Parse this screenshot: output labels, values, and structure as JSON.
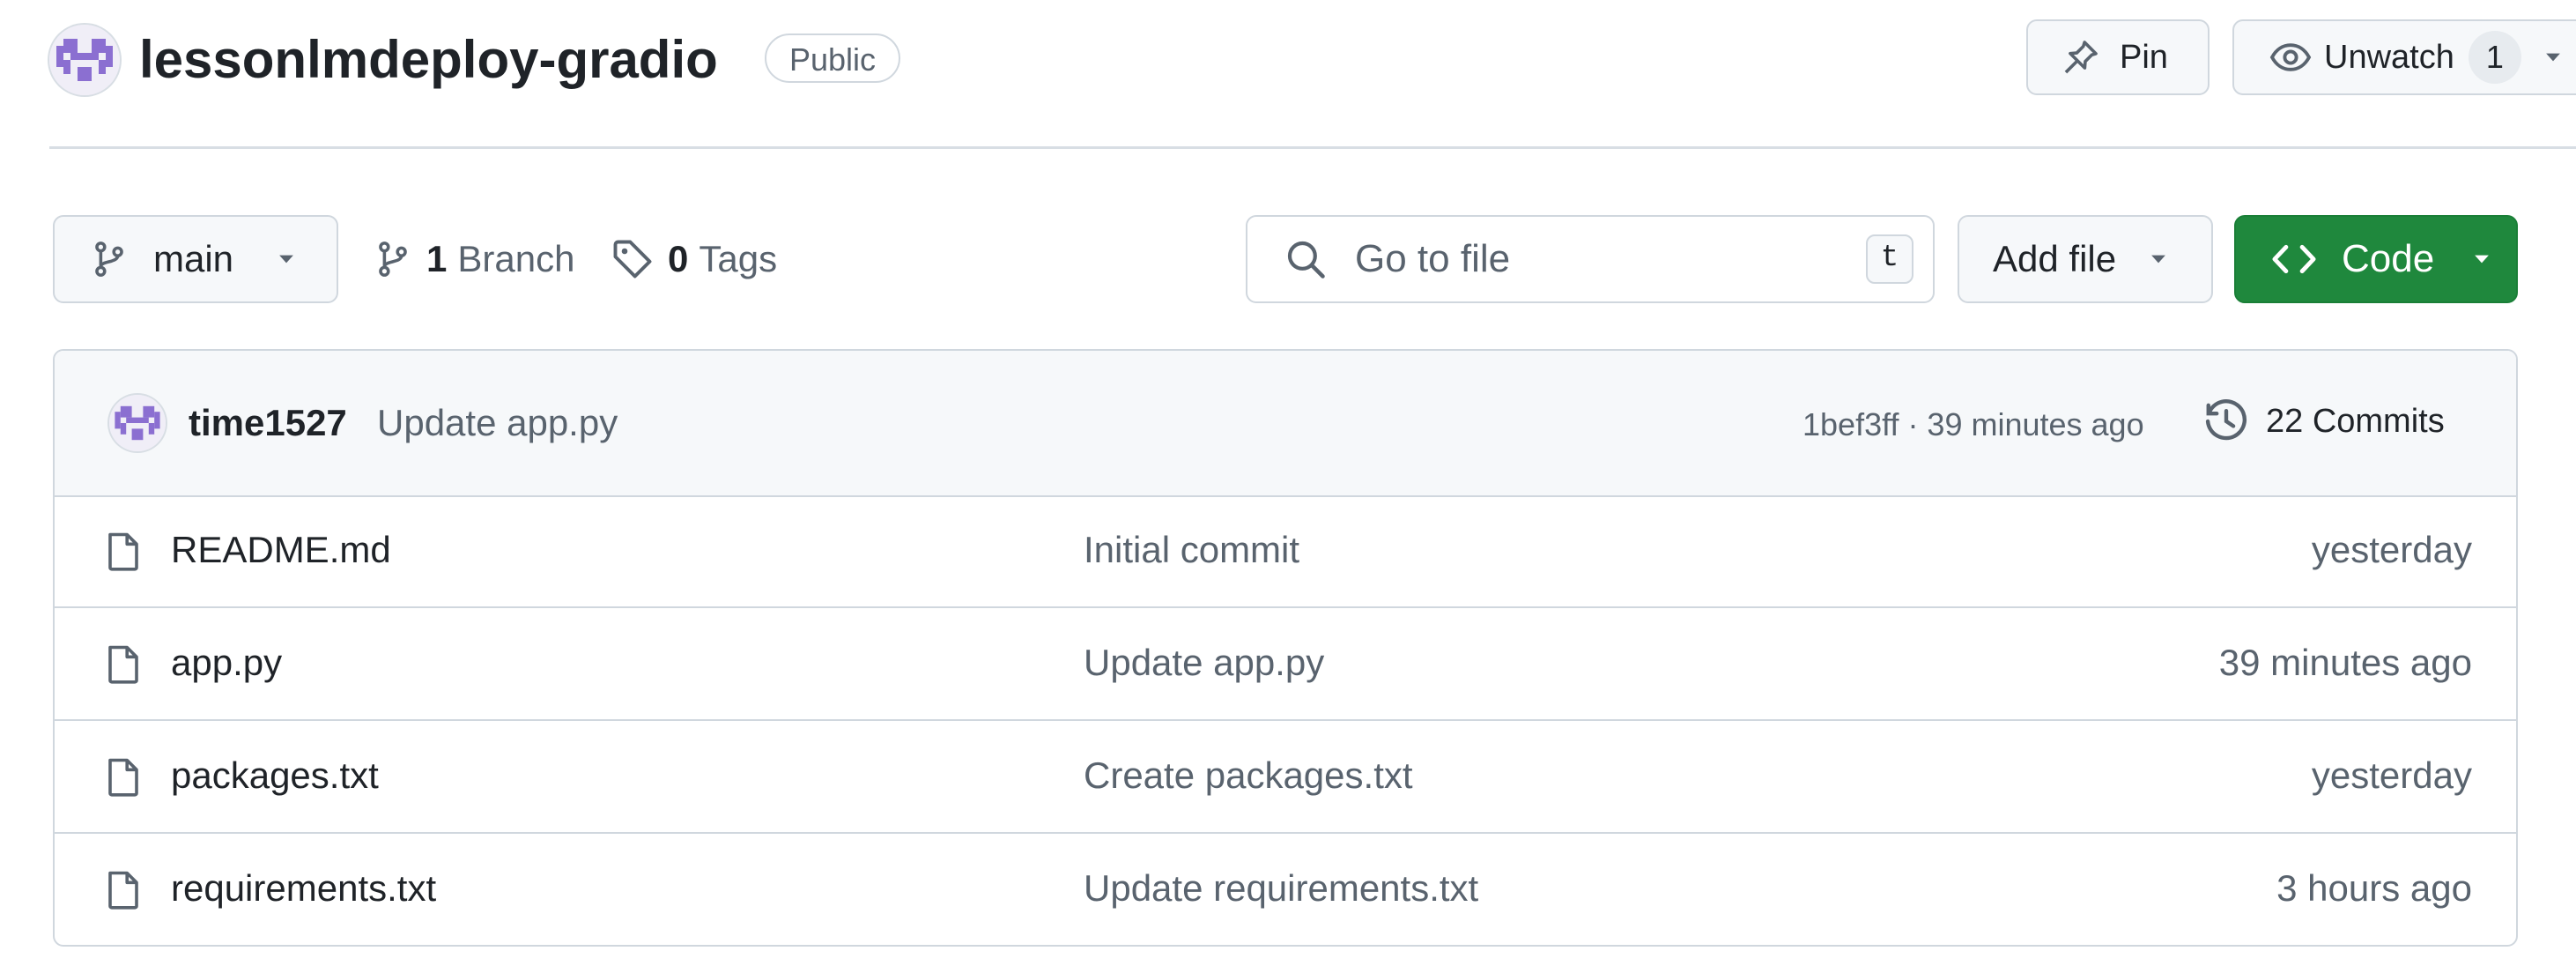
{
  "colors": {
    "accent_green": "#1f883d",
    "text_primary": "#1f2328",
    "text_muted": "#59636e",
    "border": "#d0d7de",
    "avatar_purple": "#8b6fd1"
  },
  "repo": {
    "name": "lessonlmdeploy-gradio",
    "visibility": "Public",
    "avatar_icon": "identicon-avatar"
  },
  "header_actions": {
    "pin_label": "Pin",
    "pin_icon": "pin-icon",
    "watch_label": "Unwatch",
    "watch_icon": "eye-icon",
    "watch_count": "1"
  },
  "toolbar": {
    "branch": "main",
    "branch_icon": "git-branch-icon",
    "branch_count": "1",
    "branch_label": "Branch",
    "tag_count": "0",
    "tag_label": "Tags",
    "search_placeholder": "Go to file",
    "search_shortcut": "t",
    "add_file_label": "Add file",
    "code_label": "Code"
  },
  "latest_commit": {
    "author": "time1527",
    "message": "Update app.py",
    "meta": "1bef3ff · 39 minutes ago",
    "commits_label": "22 Commits",
    "history_icon": "history-icon"
  },
  "files": [
    {
      "name": "README.md",
      "message": "Initial commit",
      "date": "yesterday"
    },
    {
      "name": "app.py",
      "message": "Update app.py",
      "date": "39 minutes ago"
    },
    {
      "name": "packages.txt",
      "message": "Create packages.txt",
      "date": "yesterday"
    },
    {
      "name": "requirements.txt",
      "message": "Update requirements.txt",
      "date": "3 hours ago"
    }
  ]
}
